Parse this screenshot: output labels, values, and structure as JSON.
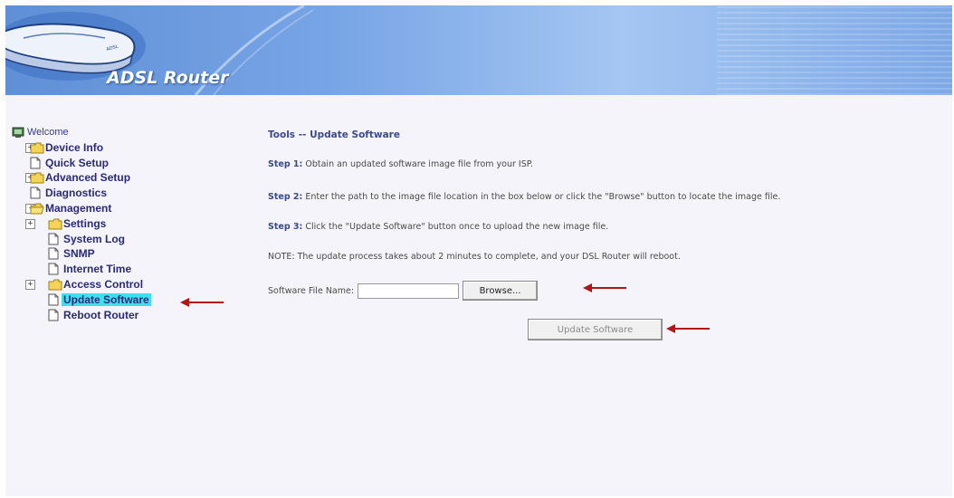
{
  "header": {
    "brand": "ADSL Router"
  },
  "sidebar": {
    "items": [
      {
        "label": "Welcome",
        "level": 0,
        "icon": "welcome-icon"
      },
      {
        "label": "Device Info",
        "level": 1,
        "expander": "+",
        "icon": "folder-icon"
      },
      {
        "label": "Quick Setup",
        "level": 1,
        "icon": "page-icon"
      },
      {
        "label": "Advanced Setup",
        "level": 1,
        "expander": "+",
        "icon": "folder-icon"
      },
      {
        "label": "Diagnostics",
        "level": 1,
        "icon": "page-icon"
      },
      {
        "label": "Management",
        "level": 1,
        "expander": "-",
        "icon": "open-folder-icon"
      },
      {
        "label": "Settings",
        "level": 2,
        "expander": "+",
        "icon": "folder-icon"
      },
      {
        "label": "System Log",
        "level": 2,
        "icon": "page-icon"
      },
      {
        "label": "SNMP",
        "level": 2,
        "icon": "page-icon"
      },
      {
        "label": "Internet Time",
        "level": 2,
        "icon": "page-icon"
      },
      {
        "label": "Access Control",
        "level": 2,
        "expander": "+",
        "icon": "folder-icon"
      },
      {
        "label": "Update Software",
        "level": 2,
        "icon": "page-icon",
        "selected": true
      },
      {
        "label": "Reboot Router",
        "level": 2,
        "icon": "page-icon"
      }
    ]
  },
  "main": {
    "title": "Tools -- Update Software",
    "step1_label": "Step 1:",
    "step1_text": "Obtain an updated software image file from your ISP.",
    "step2_label": "Step 2:",
    "step2_text": "Enter the path to the image file location in the box below or click the \"Browse\" button to locate the image file.",
    "step3_label": "Step 3:",
    "step3_text": "Click the \"Update Software\" button once to upload the new image file.",
    "note": "NOTE: The update process takes about 2 minutes to complete, and your DSL Router will reboot.",
    "file_label": "Software File Name:",
    "file_value": "",
    "browse_label": "Browse...",
    "update_label": "Update Software"
  },
  "colors": {
    "accent": "#3b4a8a",
    "selection": "#3fe0ee",
    "arrow": "#b01818"
  }
}
